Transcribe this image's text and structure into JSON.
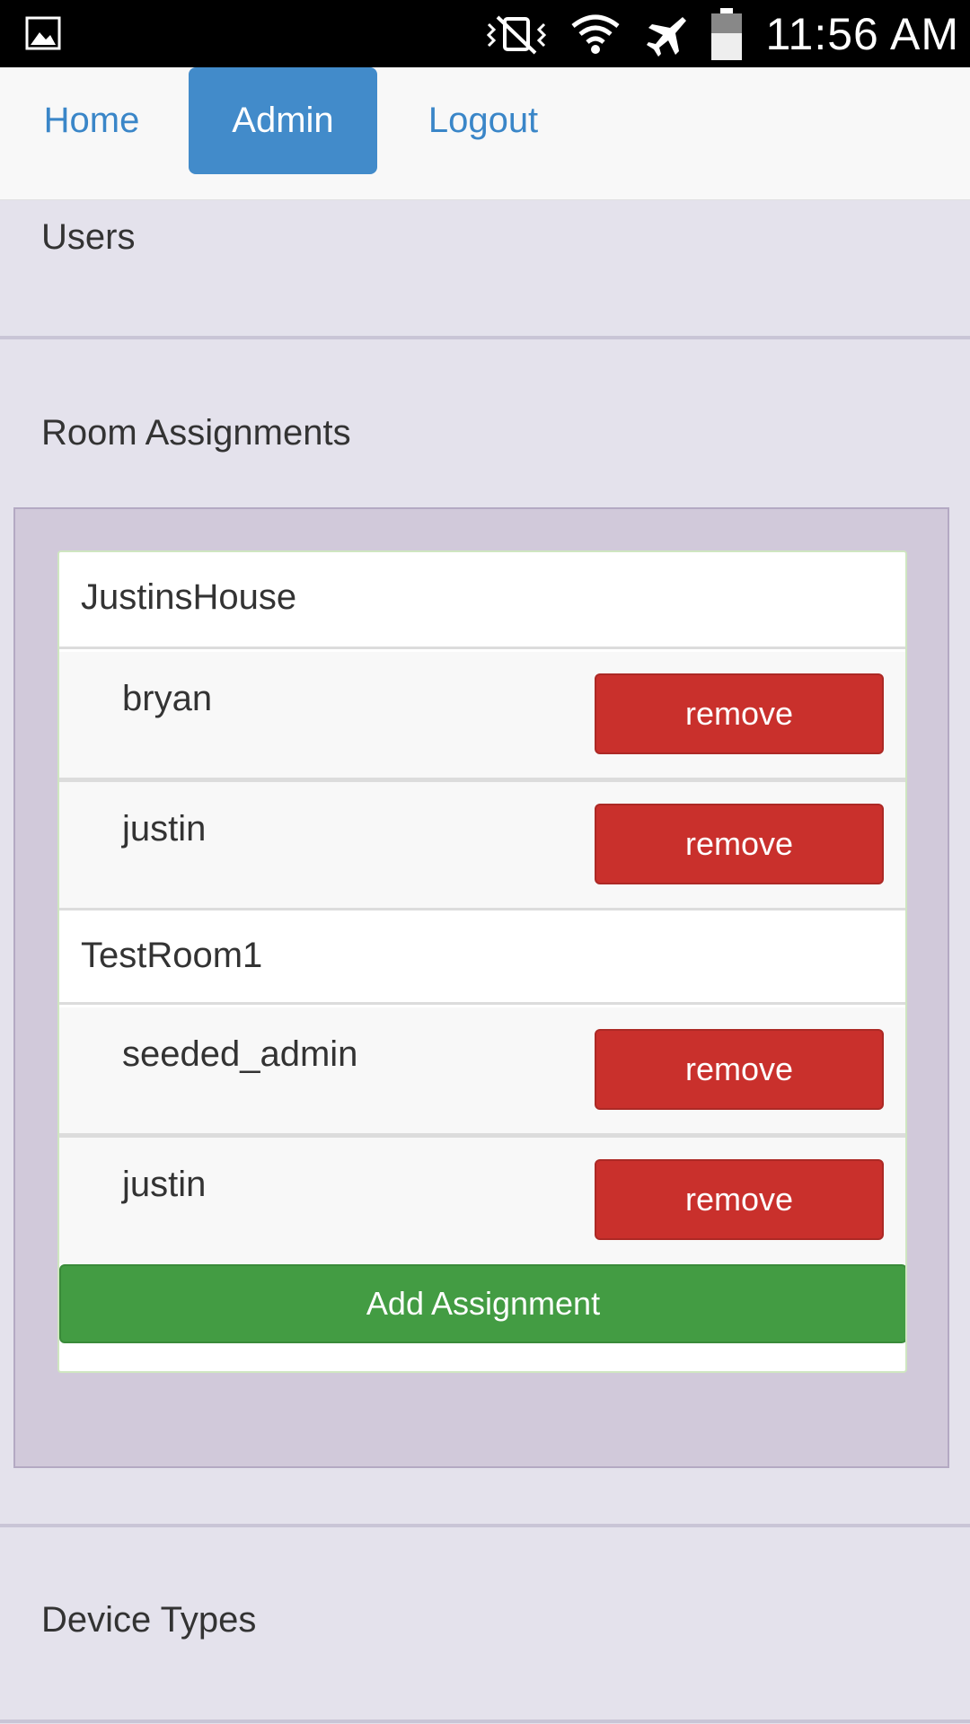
{
  "status_bar": {
    "time": "11:56 AM",
    "icons": [
      "image-icon",
      "vibrate-mute-icon",
      "wifi-icon",
      "airplane-icon",
      "battery-icon"
    ]
  },
  "nav": {
    "items": [
      {
        "label": "Home",
        "active": false
      },
      {
        "label": "Admin",
        "active": true
      },
      {
        "label": "Logout",
        "active": false
      }
    ]
  },
  "sections": {
    "users": "Users",
    "room_assignments": "Room Assignments",
    "device_types": "Device Types"
  },
  "rooms": [
    {
      "name": "JustinsHouse",
      "users": [
        "bryan",
        "justin"
      ]
    },
    {
      "name": "TestRoom1",
      "users": [
        "seeded_admin",
        "justin"
      ]
    }
  ],
  "buttons": {
    "remove_label": "remove",
    "add_assignment_label": "Add Assignment"
  },
  "colors": {
    "nav_active": "#428bca",
    "link": "#3a86c8",
    "danger": "#c9302c",
    "success": "#439c43",
    "panel": "#d1c9da",
    "page_bg": "#e4e2ec"
  }
}
